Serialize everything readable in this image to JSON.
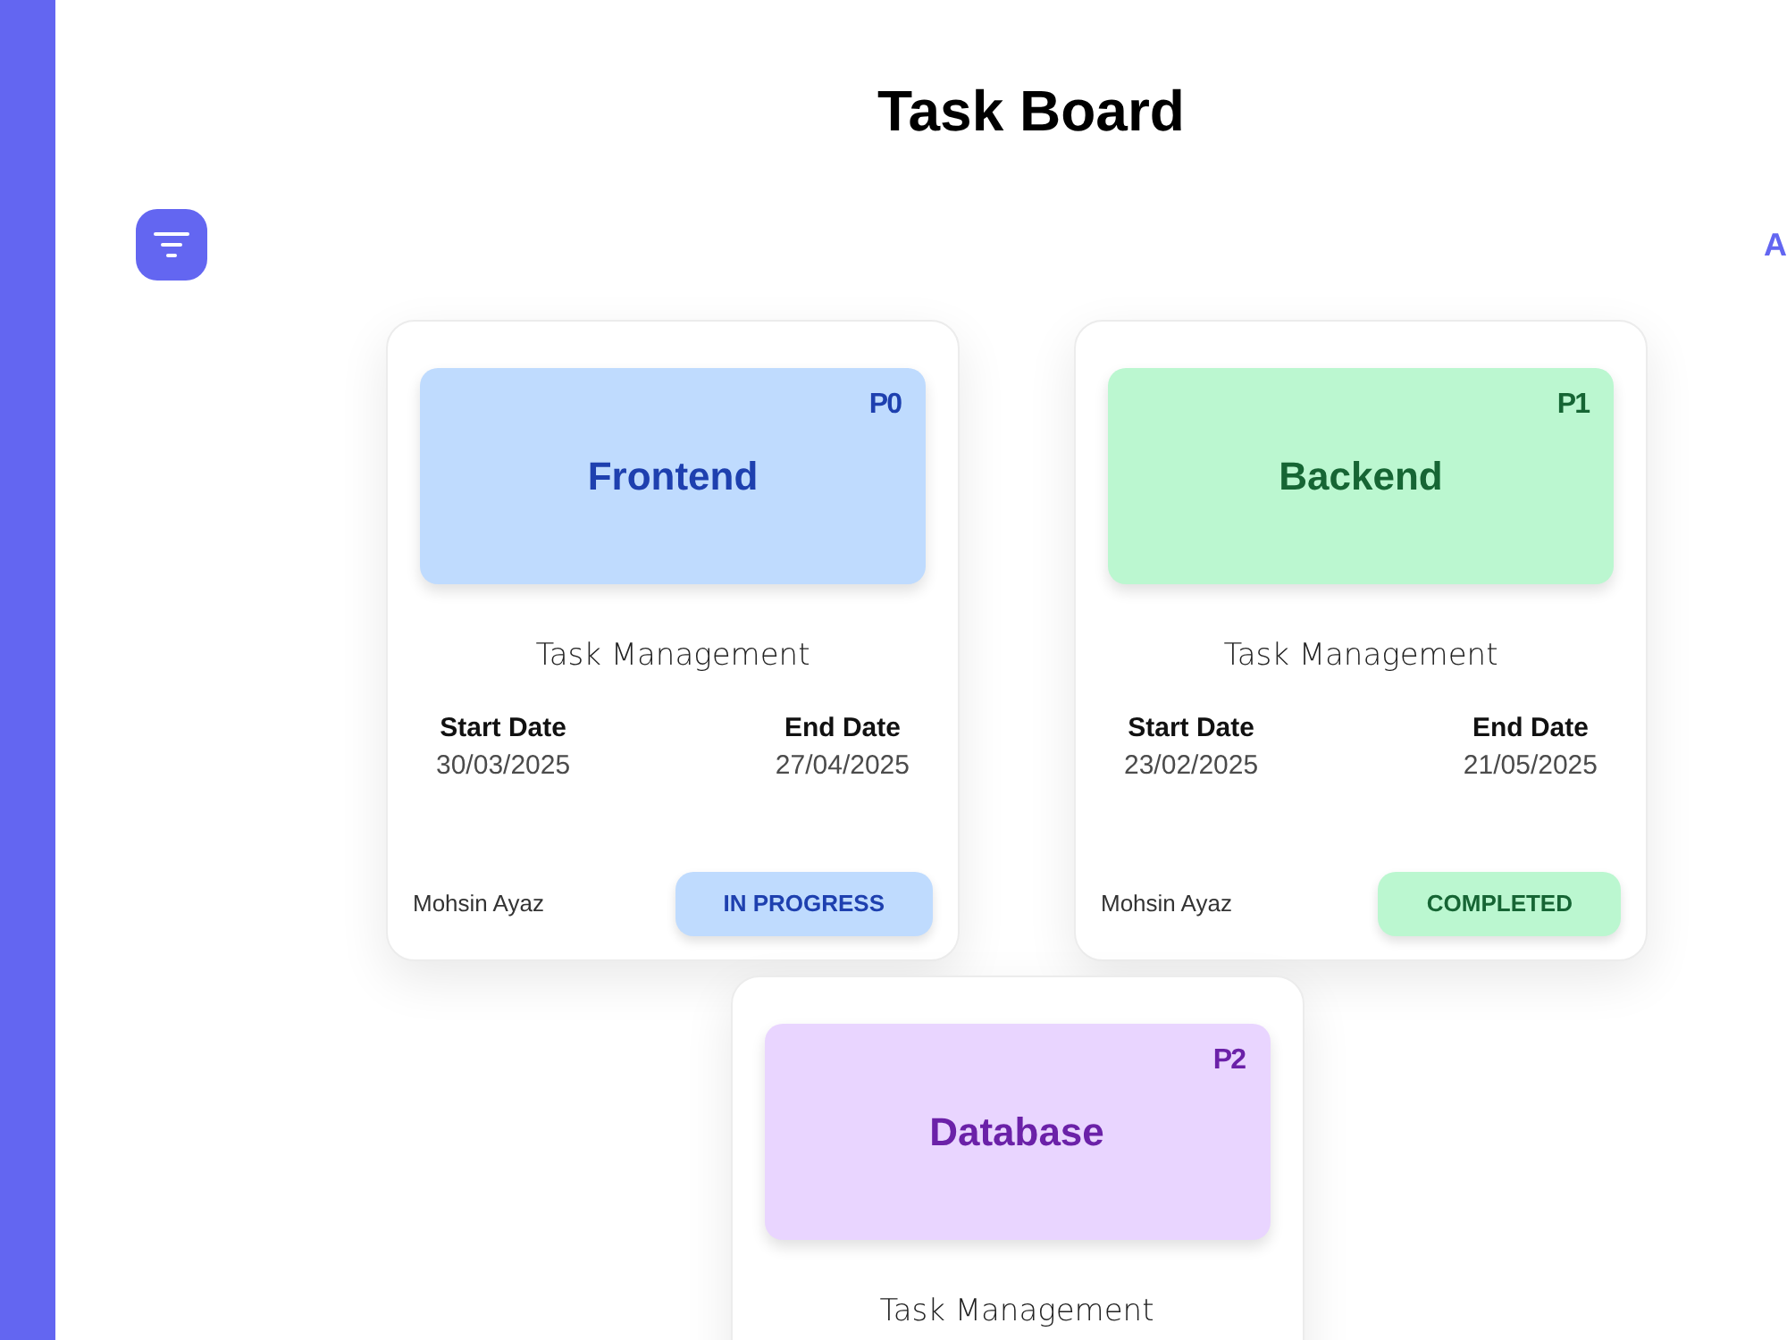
{
  "page": {
    "title": "Task Board"
  },
  "toolbar": {
    "link_text": "A"
  },
  "cards": [
    {
      "title": "Frontend",
      "priority": "P0",
      "color": "#bfdbfe",
      "subtitle": "Task Management",
      "start_label": "Start Date",
      "start_date": "30/03/2025",
      "end_label": "End Date",
      "end_date": "27/04/2025",
      "assignee": "Mohsin Ayaz",
      "status": {
        "label": "IN PROGRESS",
        "color": "#bfdbfe"
      }
    },
    {
      "title": "Backend",
      "priority": "P1",
      "color": "#bbf7d0",
      "subtitle": "Task Management",
      "start_label": "Start Date",
      "start_date": "23/02/2025",
      "end_label": "End Date",
      "end_date": "21/05/2025",
      "assignee": "Mohsin Ayaz",
      "status": {
        "label": "COMPLETED",
        "color": "#bbf7d0"
      }
    },
    {
      "title": "Database",
      "priority": "P2",
      "color": "#e9d5ff",
      "subtitle": "Task Management"
    }
  ]
}
